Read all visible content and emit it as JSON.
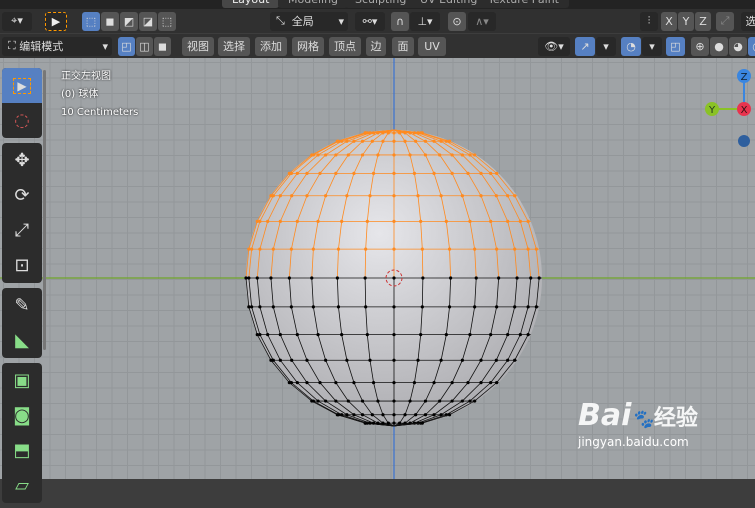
{
  "workspace_tabs": [
    "Layout",
    "Modeling",
    "Sculpting",
    "UV Editing",
    "Texture Paint"
  ],
  "header1": {
    "transform_orientation": "全局",
    "snap_axes": [
      "X",
      "Y",
      "Z"
    ],
    "right_partial": "选"
  },
  "header2": {
    "mode": "编辑模式",
    "menus": [
      "视图",
      "选择",
      "添加",
      "网格",
      "顶点",
      "边",
      "面",
      "UV"
    ]
  },
  "overlay": {
    "view_name": "正交左视图",
    "object": "(0) 球体",
    "scale": "10 Centimeters"
  },
  "gizmo": {
    "z": "Z",
    "y": "Y",
    "x": "X"
  },
  "watermark": {
    "logo": "Bai",
    "logo2": "经验",
    "url": "jingyan.baidu.com"
  },
  "colors": {
    "selected": "#ff8a1f",
    "accent": "#5680c2"
  }
}
